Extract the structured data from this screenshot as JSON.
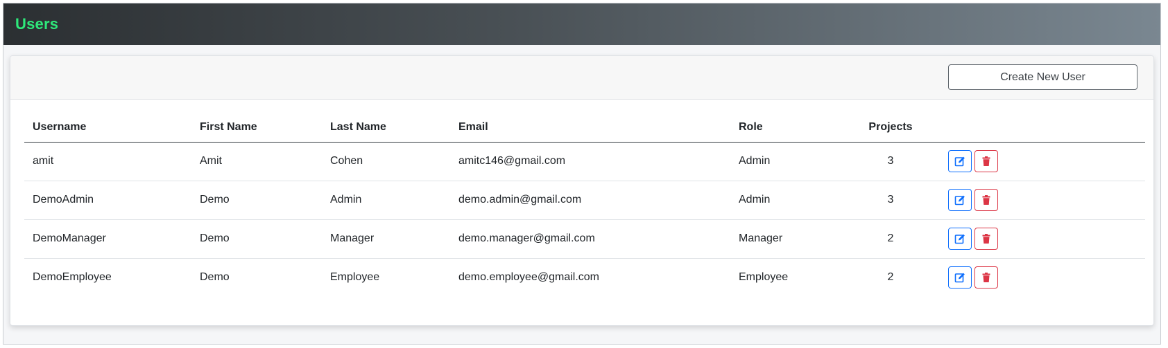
{
  "header": {
    "title": "Users"
  },
  "toolbar": {
    "create_label": "Create New User"
  },
  "table": {
    "columns": [
      "Username",
      "First Name",
      "Last Name",
      "Email",
      "Role",
      "Projects"
    ],
    "rows": [
      {
        "username": "amit",
        "first_name": "Amit",
        "last_name": "Cohen",
        "email": "amitc146@gmail.com",
        "role": "Admin",
        "projects": "3"
      },
      {
        "username": "DemoAdmin",
        "first_name": "Demo",
        "last_name": "Admin",
        "email": "demo.admin@gmail.com",
        "role": "Admin",
        "projects": "3"
      },
      {
        "username": "DemoManager",
        "first_name": "Demo",
        "last_name": "Manager",
        "email": "demo.manager@gmail.com",
        "role": "Manager",
        "projects": "2"
      },
      {
        "username": "DemoEmployee",
        "first_name": "Demo",
        "last_name": "Employee",
        "email": "demo.employee@gmail.com",
        "role": "Employee",
        "projects": "2"
      }
    ]
  },
  "icons": {
    "edit": "edit-icon",
    "delete": "trash-icon"
  },
  "colors": {
    "brand": "#2ee87a",
    "edit": "#0d6efd",
    "delete": "#dc3545"
  }
}
